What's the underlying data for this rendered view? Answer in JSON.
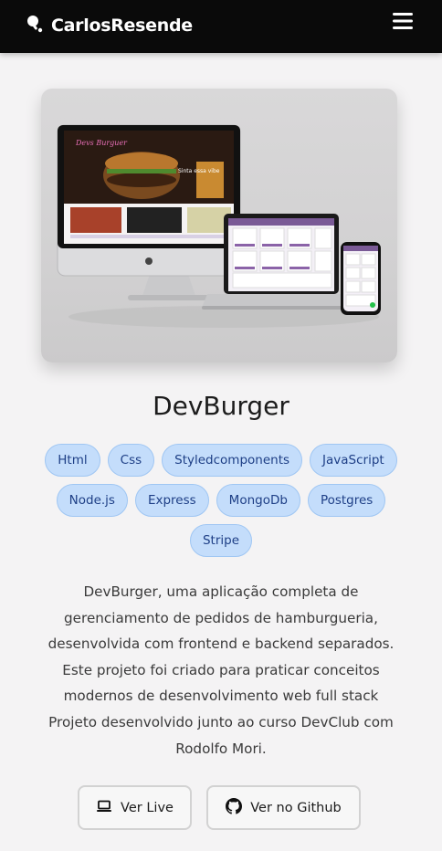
{
  "header": {
    "brand_name": "CarlosResende",
    "brand_icon": "ping-pong-icon",
    "menu_icon": "hamburger-menu-icon",
    "background_color": "#0a0a0a"
  },
  "project": {
    "image_alt": "DevBurger devices mockup",
    "title": "DevBurger",
    "tags": [
      "Html",
      "Css",
      "Styledcomponents",
      "JavaScript",
      "Node.js",
      "Express",
      "MongoDb",
      "Postgres",
      "Stripe"
    ],
    "description": "DevBurger, uma aplicação completa de gerenciamento de pedidos de hamburgueria, desenvolvida com frontend e backend separados. Este projeto foi criado para praticar conceitos modernos de desenvolvimento web full stack Projeto desenvolvido junto ao curso DevClub com Rodolfo Mori."
  },
  "actions": {
    "live_label": "Ver Live",
    "live_icon": "laptop-icon",
    "github_label": "Ver no Github",
    "github_icon": "github-icon"
  },
  "colors": {
    "tag_background": "#c4ddfb",
    "tag_text": "#1e3f86",
    "page_background": "#f4f3f4"
  }
}
